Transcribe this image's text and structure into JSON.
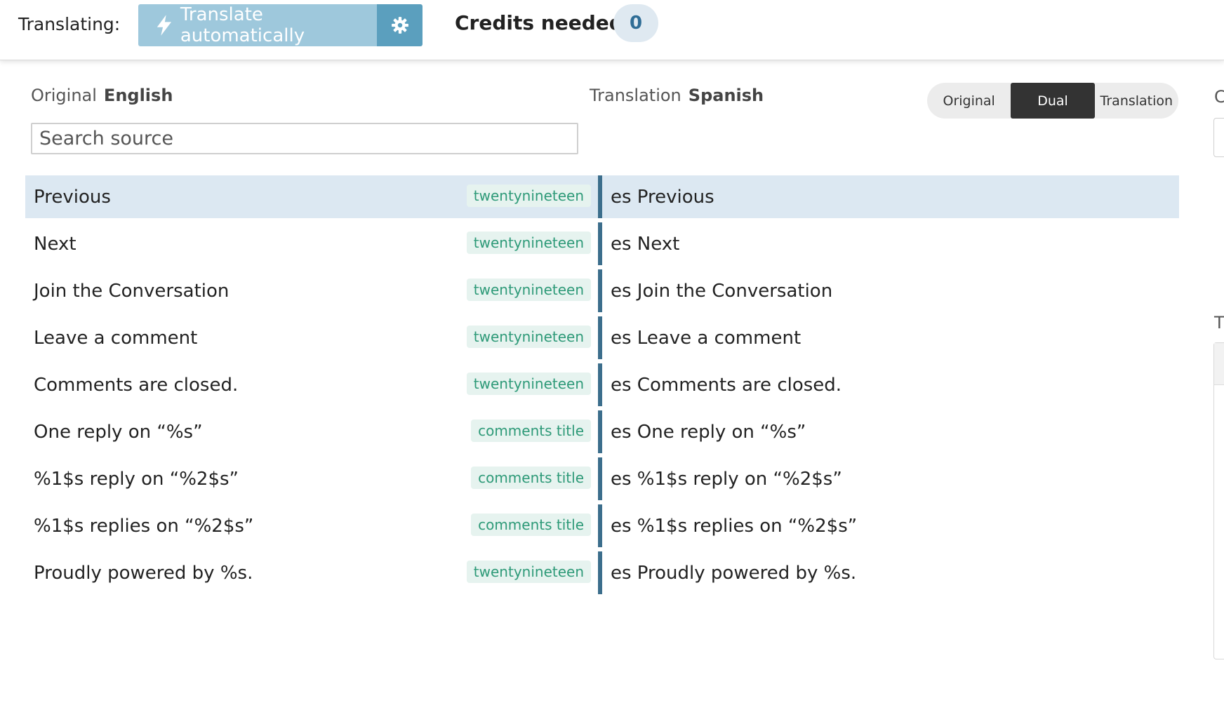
{
  "toolbar": {
    "translating_label": "Translating:",
    "auto_translate_label": "Translate automatically",
    "credits_label": "Credits needed",
    "credits_value": "0"
  },
  "languages": {
    "original_prefix": "Original",
    "original_name": "English",
    "translation_prefix": "Translation",
    "translation_name": "Spanish"
  },
  "view_toggle": {
    "options": [
      "Original",
      "Dual",
      "Translation"
    ],
    "active": "Dual"
  },
  "search": {
    "placeholder": "Search source",
    "value": ""
  },
  "strings": [
    {
      "source": "Previous",
      "tag": "twentynineteen",
      "translation": "es Previous",
      "selected": true
    },
    {
      "source": "Next",
      "tag": "twentynineteen",
      "translation": "es Next"
    },
    {
      "source": "Join the Conversation",
      "tag": "twentynineteen",
      "translation": "es Join the Conversation"
    },
    {
      "source": "Leave a comment",
      "tag": "twentynineteen",
      "translation": "es Leave a comment"
    },
    {
      "source": "Comments are closed.",
      "tag": "twentynineteen",
      "translation": "es Comments are closed."
    },
    {
      "source": "One reply on “%s”",
      "tag": "comments title",
      "translation": "es One reply on “%s”"
    },
    {
      "source": "%1$s reply on “%2$s”",
      "tag": "comments title",
      "translation": "es %1$s reply on “%2$s”"
    },
    {
      "source": "%1$s replies on “%2$s”",
      "tag": "comments title",
      "translation": "es %1$s replies on “%2$s”"
    },
    {
      "source": "Proudly powered by %s.",
      "tag": "twentynineteen",
      "translation": "es Proudly powered by %s."
    }
  ],
  "right_panel": {
    "label_top": "C",
    "label_mid": "T"
  },
  "colors": {
    "auto_button": "#9ec8dc",
    "gear_button": "#5b9fbe",
    "selected_row": "#dce8f2",
    "divider": "#3c6e8c",
    "tag_text": "#2e9a78",
    "tag_bg": "#e6f3ef"
  },
  "icons": {
    "auto_translate": "lightning-bolt-icon",
    "settings": "gear-icon"
  }
}
